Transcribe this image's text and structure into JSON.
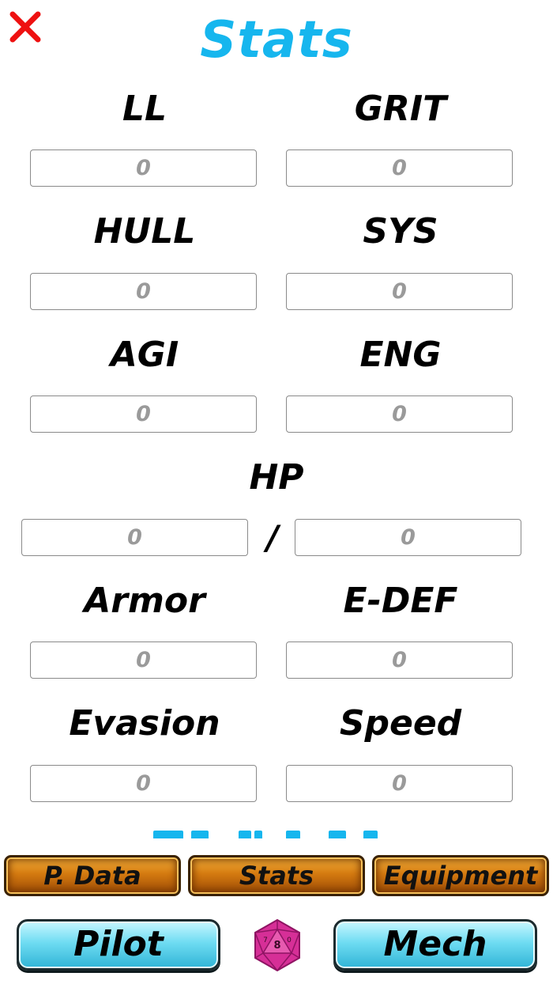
{
  "header": {
    "title": "Stats",
    "close_icon": "close-icon",
    "close_color": "#ee1111",
    "title_color": "#16b6ee"
  },
  "stats": {
    "ll": {
      "label": "LL",
      "placeholder": "0"
    },
    "grit": {
      "label": "GRIT",
      "placeholder": "0"
    },
    "hull": {
      "label": "HULL",
      "placeholder": "0"
    },
    "sys": {
      "label": "SYS",
      "placeholder": "0"
    },
    "agi": {
      "label": "AGI",
      "placeholder": "0"
    },
    "eng": {
      "label": "ENG",
      "placeholder": "0"
    },
    "hp": {
      "label": "HP",
      "current_placeholder": "0",
      "separator": "/",
      "max_placeholder": "0"
    },
    "armor": {
      "label": "Armor",
      "placeholder": "0"
    },
    "edef": {
      "label": "E-DEF",
      "placeholder": "0"
    },
    "evasion": {
      "label": "Evasion",
      "placeholder": "0"
    },
    "speed": {
      "label": "Speed",
      "placeholder": "0"
    }
  },
  "tabs": [
    {
      "label": "P. Data"
    },
    {
      "label": "Stats"
    },
    {
      "label": "Equipment"
    }
  ],
  "bottom_nav": {
    "pilot_label": "Pilot",
    "mech_label": "Mech",
    "dice_icon": "d20-dice-icon",
    "dice_numbers": [
      "7",
      "8",
      "0"
    ],
    "dice_color": "#d62f97"
  },
  "colors": {
    "tab_orange": "#d47a10",
    "button_cyan": "#6fdcf2"
  }
}
